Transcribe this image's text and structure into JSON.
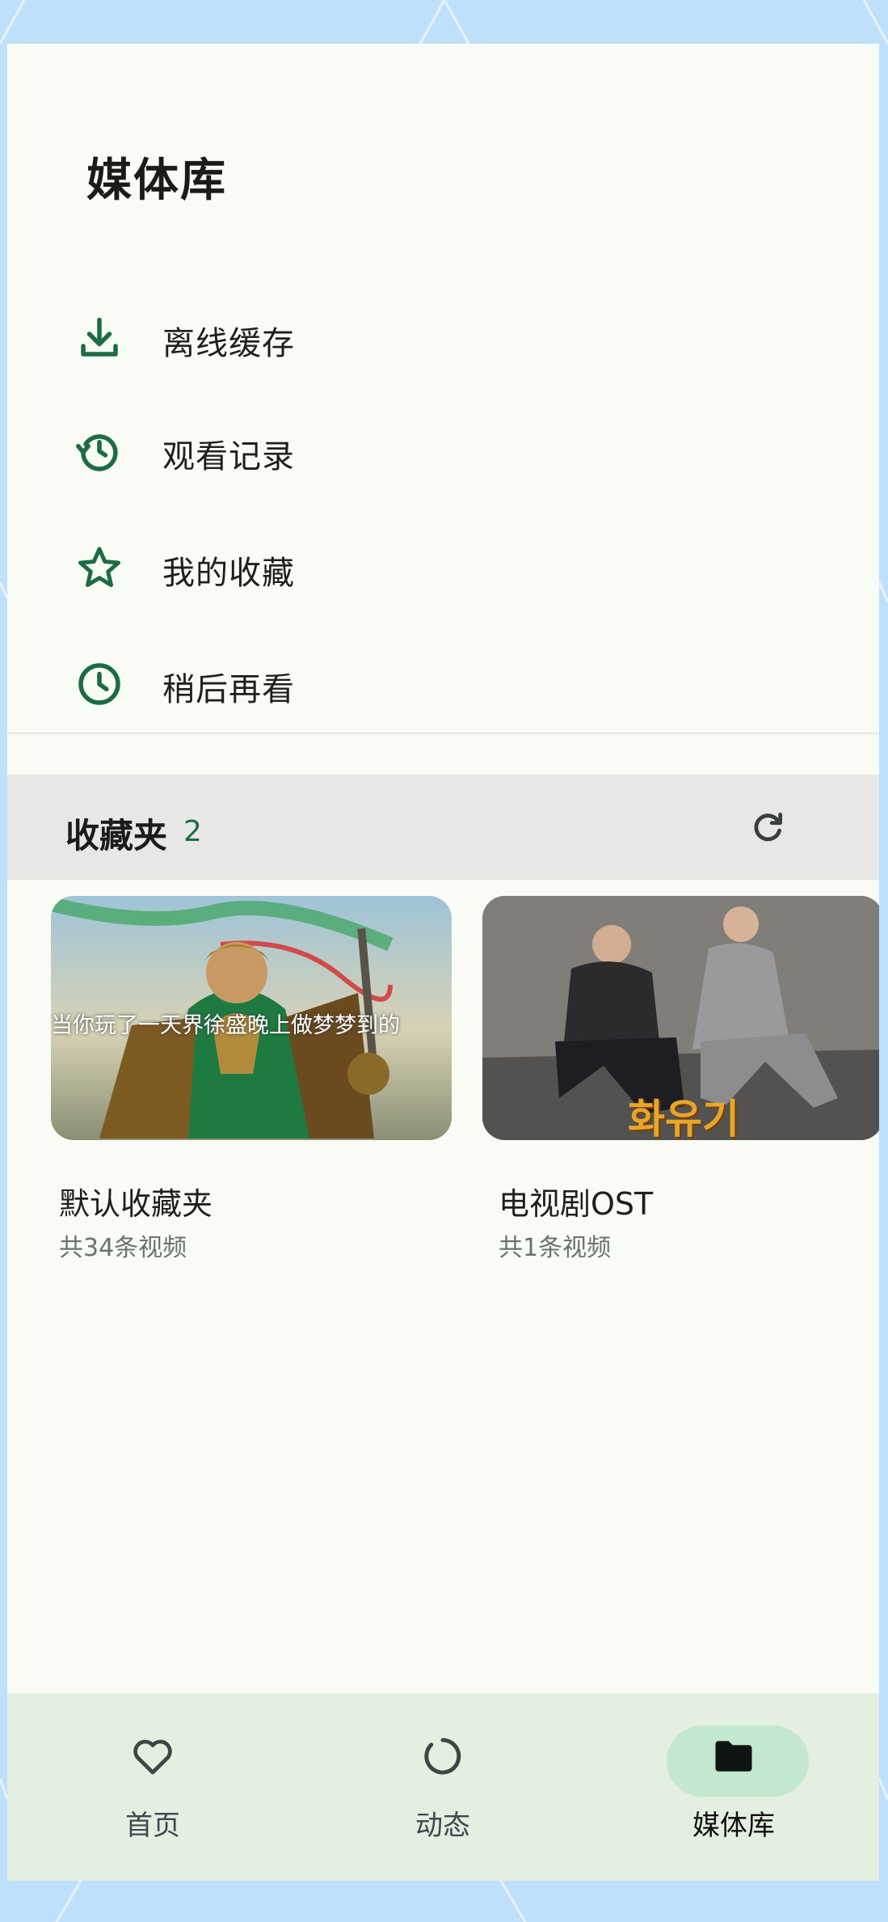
{
  "colors": {
    "accent": "#1d6b45",
    "background": "#f9fbf5",
    "wallpaper": "#bfe0fb",
    "nav_background": "#e3efe1",
    "nav_pill": "#c4e8cd"
  },
  "page": {
    "title": "媒体库"
  },
  "menu": [
    {
      "label": "离线缓存",
      "icon": "download-icon"
    },
    {
      "label": "观看记录",
      "icon": "history-icon"
    },
    {
      "label": "我的收藏",
      "icon": "star-icon"
    },
    {
      "label": "稍后再看",
      "icon": "clock-icon"
    }
  ],
  "favorites": {
    "title": "收藏夹",
    "count": "2",
    "refresh_icon": "refresh-icon",
    "folders": [
      {
        "title": "默认收藏夹",
        "subtitle": "共34条视频",
        "thumb_caption": "当你玩了一天界徐盛晚上做梦梦到的"
      },
      {
        "title": "电视剧OST",
        "subtitle": "共1条视频",
        "thumb_caption": "화유기"
      }
    ]
  },
  "bottom_nav": [
    {
      "label": "首页",
      "icon": "heart-icon",
      "active": false
    },
    {
      "label": "动态",
      "icon": "loading-circle-icon",
      "active": false
    },
    {
      "label": "媒体库",
      "icon": "folder-icon",
      "active": true
    }
  ]
}
